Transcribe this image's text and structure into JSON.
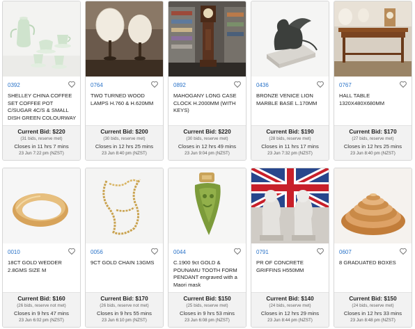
{
  "lots": [
    {
      "lot": "0392",
      "title": "SHELLEY CHINA COFFEE SET COFFEE POT C/SUGAR 4C/S & SMALL DISH GREEN COLOURWAY",
      "bid": "Current Bid: $220",
      "bids": "(31 bids, reserve met)",
      "closes": "Closes in 11 hrs 7 mins",
      "date": "23 Jun 7:22 pm (NZST)"
    },
    {
      "lot": "0764",
      "title": "TWO TURNED WOOD LAMPS H.760 & H.620mm",
      "bid": "Current Bid: $200",
      "bids": "(30 bids, reserve met)",
      "closes": "Closes in 12 hrs 25 mins",
      "date": "23 Jun 8:40 pm (NZST)"
    },
    {
      "lot": "0892",
      "title": "MAHOGANY LONG CASE CLOCK H.2000mm (WITH KEYS)",
      "bid": "Current Bid: $220",
      "bids": "(30 bids, reserve met)",
      "closes": "Closes in 12 hrs 49 mins",
      "date": "23 Jun 9:04 pm (NZST)"
    },
    {
      "lot": "0436",
      "title": "BRONZE VENICE LION MARBLE BASE L.170mm",
      "bid": "Current Bid: $190",
      "bids": "(28 bids, reserve met)",
      "closes": "Closes in 11 hrs 17 mins",
      "date": "23 Jun 7:32 pm (NZST)"
    },
    {
      "lot": "0767",
      "title": "HALL TABLE 1320x480x680mm",
      "bid": "Current Bid: $170",
      "bids": "(27 bids, reserve met)",
      "closes": "Closes in 12 hrs 25 mins",
      "date": "23 Jun 8:40 pm (NZST)"
    },
    {
      "lot": "0010",
      "title": "18CT GOLD WEDDER 2.8GMS SIZE M",
      "bid": "Current Bid: $160",
      "bids": "(26 bids, reserve not met)",
      "closes": "Closes in 9 hrs 47 mins",
      "date": "23 Jun 6:02 pm (NZST)"
    },
    {
      "lot": "0056",
      "title": "9CT GOLD CHAIN 13GMS",
      "bid": "Current Bid: $170",
      "bids": "(26 bids, reserve not met)",
      "closes": "Closes in 9 hrs 55 mins",
      "date": "23 Jun 6:10 pm (NZST)"
    },
    {
      "lot": "0044",
      "title": "C.1900 9ct GOLD & POUNAMU TOOTH FORM PENDANT engraved with a Maori mask",
      "bid": "Current Bid: $150",
      "bids": "(25 bids, reserve met)",
      "closes": "Closes in 9 hrs 53 mins",
      "date": "23 Jun 6:08 pm (NZST)"
    },
    {
      "lot": "0791",
      "title": "PR OF CONCRETE GRIFFINS H550mm",
      "bid": "Current Bid: $140",
      "bids": "(24 bids, reserve met)",
      "closes": "Closes in 12 hrs 29 mins",
      "date": "23 Jun 8:44 pm (NZST)"
    },
    {
      "lot": "0607",
      "title": "8 GRADUATED BOXES",
      "bid": "Current Bid: $150",
      "bids": "(24 bids, reserve met)",
      "closes": "Closes in 12 hrs 33 mins",
      "date": "23 Jun 8:48 pm (NZST)"
    }
  ],
  "colors": {
    "lot_link": "#2a73c8",
    "bid_panel": "#f2f2f2",
    "card_border": "#d6d6d6"
  },
  "icons": {
    "favourite": "heart-outline-icon"
  }
}
